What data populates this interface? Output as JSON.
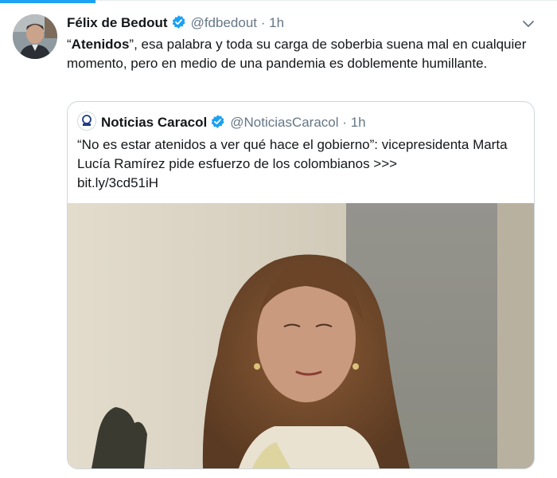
{
  "tweet": {
    "author_name": "Félix de Bedout",
    "author_handle": "@fdbedout",
    "separator": "·",
    "time": "1h",
    "text_bold": "Atenidos",
    "text_open_quote": "“",
    "text_close_quote": "”",
    "text_rest": ", esa palabra y toda su carga de soberbia suena mal en cualquier momento, pero en medio de una pandemia es doblemente humillante."
  },
  "quoted": {
    "author_name": "Noticias Caracol",
    "author_handle": "@NoticiasCaracol",
    "separator": "·",
    "time": "1h",
    "text": "“No es estar atenidos a ver qué hace el gobierno”: vicepresidenta Marta Lucía Ramírez pide esfuerzo de los colombianos  >>>",
    "link": "bit.ly/3cd51iH"
  },
  "icons": {
    "verified": "verified-badge-icon",
    "caret": "chevron-down-icon"
  },
  "colors": {
    "accent": "#1da1f2",
    "text": "#14171a",
    "muted": "#657786",
    "border": "#ccd6dd"
  }
}
